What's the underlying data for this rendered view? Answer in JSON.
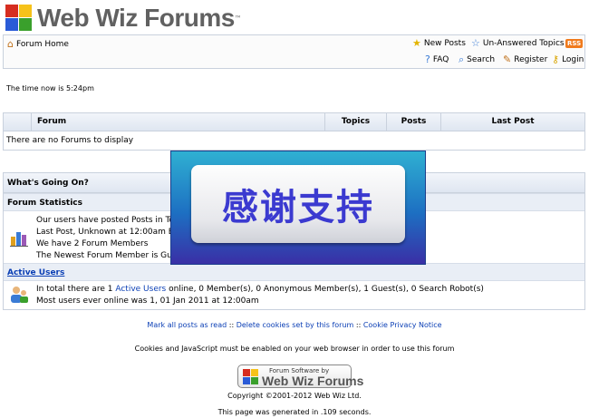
{
  "logo": {
    "text": "Web Wiz Forums",
    "tm": "™"
  },
  "nav": {
    "forum_home": "Forum Home",
    "new_posts": "New Posts",
    "unanswered": "Un-Answered Topics",
    "rss": "RSS",
    "faq": "FAQ",
    "search": "Search",
    "register": "Register",
    "login": "Login"
  },
  "time_text": "The time now is 5:24pm",
  "forum_table": {
    "columns": [
      "Forum",
      "Topics",
      "Posts",
      "Last Post"
    ],
    "empty": "There are no Forums to display"
  },
  "whats_going_on": {
    "title": "What's Going On?",
    "stats_title": "Forum Statistics",
    "stats_lines": [
      "Our users have posted Posts in To",
      "Last Post, Unknown at 12:00am E",
      "We have 2 Forum Members",
      "The Newest Forum Member is Gu"
    ],
    "active_title": "Active Users",
    "active_prefix": "In total there are 1 ",
    "active_link": "Active Users",
    "active_suffix": " online, 0 Member(s), 0 Anonymous Member(s), 1 Guest(s), 0 Search Robot(s)",
    "most_users": "Most users ever online was 1, 01 Jan 2011 at 12:00am"
  },
  "overlay_text": "感谢支持",
  "footer": {
    "mark_read": "Mark all posts as read",
    "sep": " :: ",
    "delete_cookies": "Delete cookies set by this forum",
    "cookie_privacy": "Cookie Privacy Notice",
    "cookies_note": "Cookies and JavaScript must be enabled on your web browser in order to use this forum",
    "badge_small": "Forum Software by",
    "badge_big": "Web Wiz Forums",
    "copyright": "Copyright ©2001-2012 Web Wiz Ltd.",
    "generated": "This page was generated in .109 seconds."
  },
  "colors": {
    "link": "#0b3fb5",
    "logo_red": "#d62d20",
    "logo_green": "#3aa02c",
    "logo_blue": "#2a5bd7",
    "logo_yellow": "#f6c21a"
  }
}
